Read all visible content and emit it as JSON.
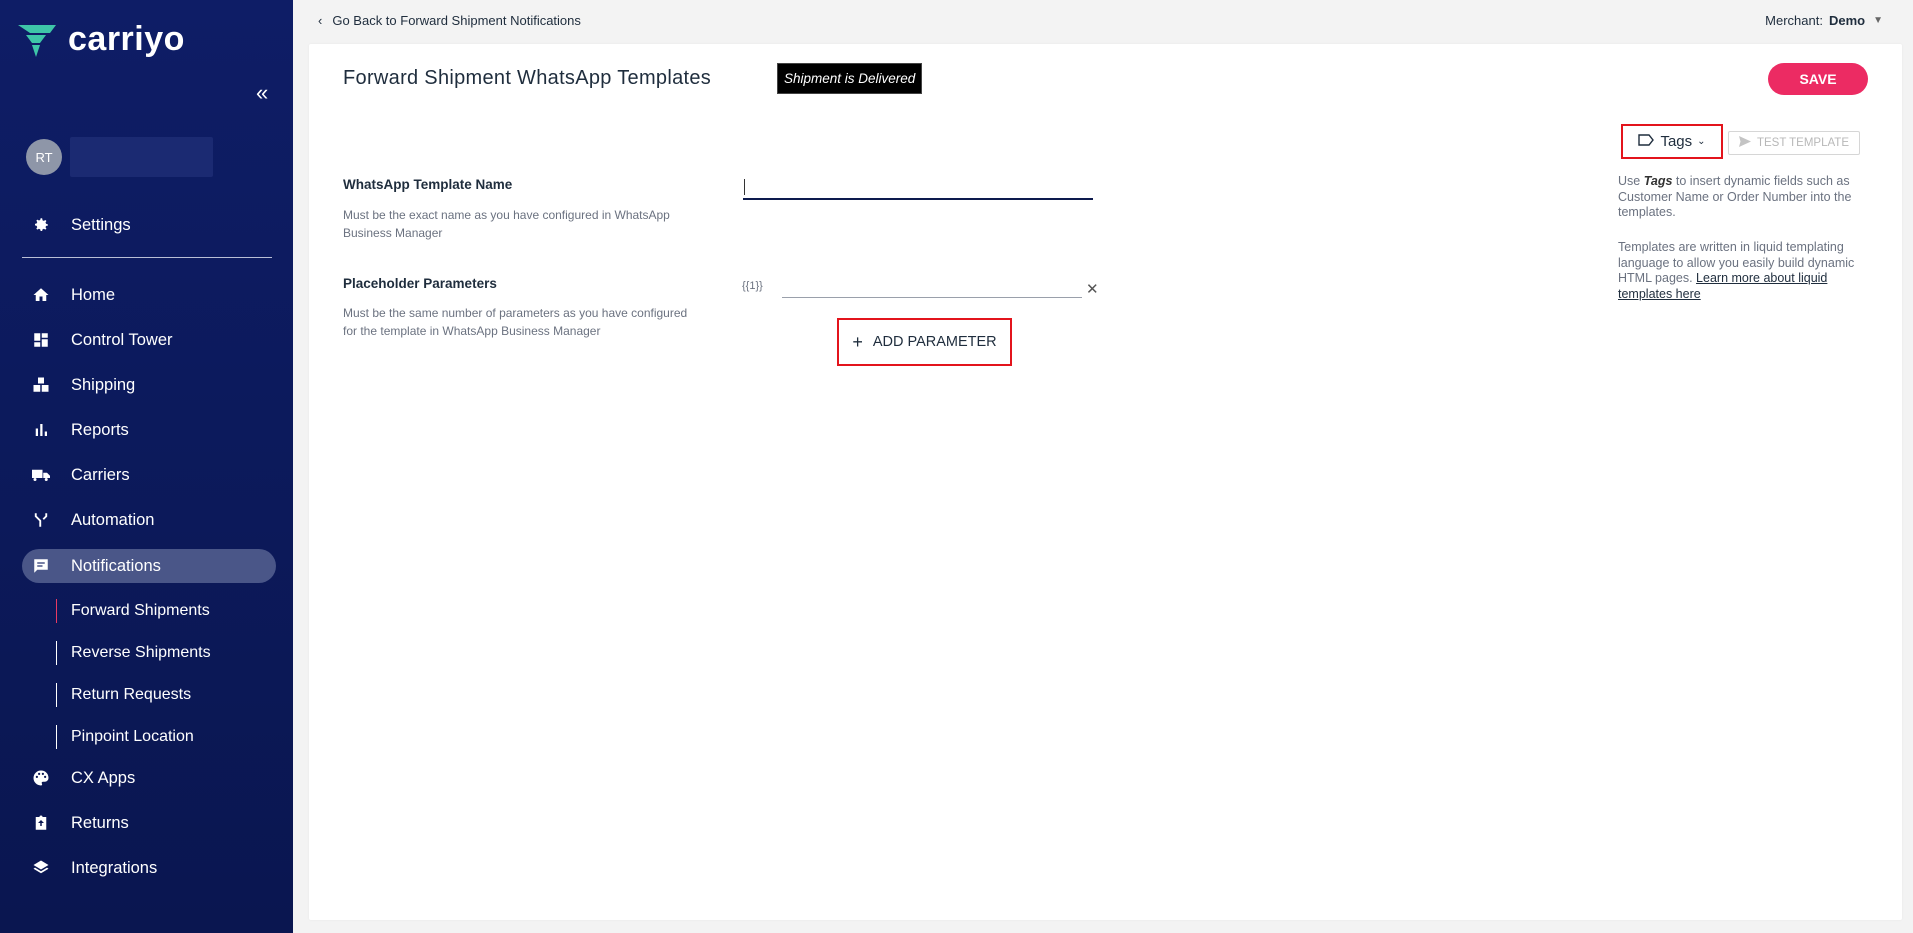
{
  "app": {
    "brand": "carriyo"
  },
  "sidebar": {
    "user_initials": "RT",
    "settings_label": "Settings",
    "items": [
      {
        "label": "Home",
        "icon": "home-icon"
      },
      {
        "label": "Control Tower",
        "icon": "dashboard-icon"
      },
      {
        "label": "Shipping",
        "icon": "boxes-icon"
      },
      {
        "label": "Reports",
        "icon": "bar-chart-icon"
      },
      {
        "label": "Carriers",
        "icon": "truck-icon"
      },
      {
        "label": "Automation",
        "icon": "fork-icon"
      },
      {
        "label": "Notifications",
        "icon": "chat-icon"
      },
      {
        "label": "CX Apps",
        "icon": "palette-icon"
      },
      {
        "label": "Returns",
        "icon": "return-box-icon"
      },
      {
        "label": "Integrations",
        "icon": "layers-icon"
      }
    ],
    "sub_items": [
      {
        "label": "Forward Shipments"
      },
      {
        "label": "Reverse Shipments"
      },
      {
        "label": "Return Requests"
      },
      {
        "label": "Pinpoint Location"
      }
    ]
  },
  "topbar": {
    "back_label": "Go Back to Forward Shipment Notifications",
    "merchant_label": "Merchant:",
    "merchant_value": "Demo"
  },
  "main": {
    "title": "Forward Shipment WhatsApp Templates",
    "status_chip": "Shipment is Delivered",
    "save_label": "SAVE",
    "tags_label": "Tags",
    "test_label": "TEST TEMPLATE",
    "help_prefix": "Use ",
    "help_tags": "Tags",
    "help_suffix": " to insert dynamic fields such as Customer Name or Order Number into the templates.",
    "help2_text": "Templates are written in liquid templating language to allow you easily build dynamic HTML pages. ",
    "help2_link": "Learn more about liquid templates here",
    "template_name_label": "WhatsApp Template Name",
    "template_name_help": "Must be the exact name as you have configured in WhatsApp Business Manager",
    "template_name_value": "",
    "params_label": "Placeholder Parameters",
    "params_help": "Must be the same number of parameters as you have configured for the template in WhatsApp Business Manager",
    "param_1_label": "{{1}}",
    "param_1_value": "",
    "add_param_label": "ADD PARAMETER"
  }
}
